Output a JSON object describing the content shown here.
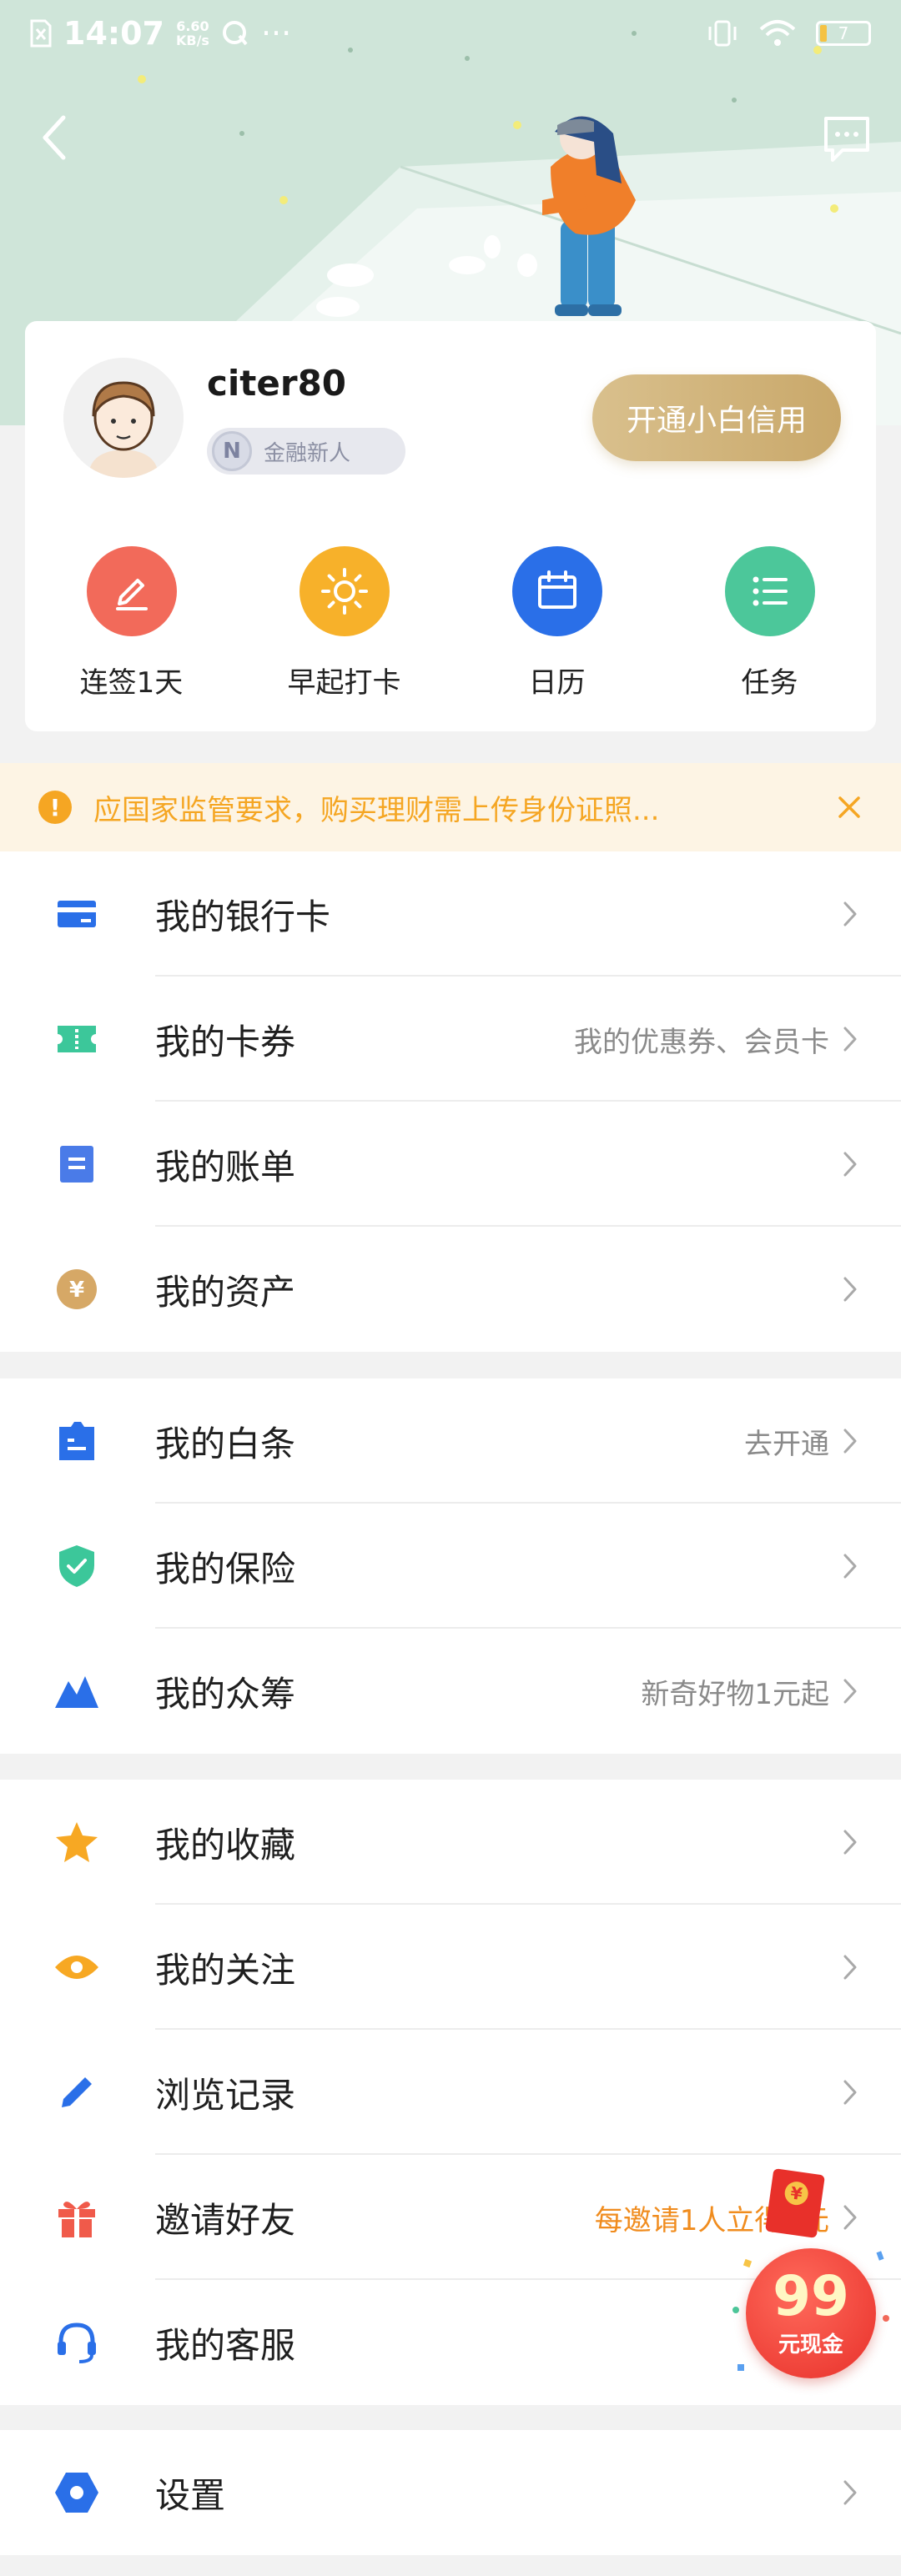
{
  "status_bar": {
    "time": "14:07",
    "net_speed_value": "6.60",
    "net_speed_unit": "KB/s",
    "more": "···",
    "battery": "7"
  },
  "profile": {
    "username": "citer80",
    "member_level": "金融新人",
    "member_icon_letter": "N",
    "credit_button": "开通小白信用"
  },
  "quick_actions": [
    {
      "label": "连签1天",
      "color": "#f26a5a",
      "icon": "pencil-icon"
    },
    {
      "label": "早起打卡",
      "color": "#f7b12a",
      "icon": "sun-icon"
    },
    {
      "label": "日历",
      "color": "#2a6fe8",
      "icon": "calendar-icon"
    },
    {
      "label": "任务",
      "color": "#4cc79a",
      "icon": "list-icon"
    }
  ],
  "notice": {
    "text": "应国家监管要求，购买理财需上传身份证照..."
  },
  "group1": [
    {
      "label": "我的银行卡",
      "hint": "",
      "icon": "bank-card-icon"
    },
    {
      "label": "我的卡券",
      "hint": "我的优惠券、会员卡",
      "icon": "coupon-icon"
    },
    {
      "label": "我的账单",
      "hint": "",
      "icon": "bill-icon"
    },
    {
      "label": "我的资产",
      "hint": "",
      "icon": "asset-icon"
    }
  ],
  "group2": [
    {
      "label": "我的白条",
      "hint": "去开通",
      "icon": "baitiao-icon"
    },
    {
      "label": "我的保险",
      "hint": "",
      "icon": "insurance-shield-icon"
    },
    {
      "label": "我的众筹",
      "hint": "新奇好物1元起",
      "icon": "crowdfunding-icon"
    }
  ],
  "group3": [
    {
      "label": "我的收藏",
      "hint": "",
      "icon": "star-icon"
    },
    {
      "label": "我的关注",
      "hint": "",
      "icon": "eye-icon"
    },
    {
      "label": "浏览记录",
      "hint": "",
      "icon": "pen-icon"
    },
    {
      "label": "邀请好友",
      "hint": "每邀请1人立得3元",
      "icon": "gift-icon"
    },
    {
      "label": "我的客服",
      "hint": "",
      "icon": "headset-icon"
    }
  ],
  "group4": [
    {
      "label": "设置",
      "hint": "",
      "icon": "settings-icon"
    }
  ],
  "promo": {
    "amount": "99",
    "label": "元现金"
  },
  "colors": {
    "accent_blue": "#2a6fe8",
    "notice_orange": "#f5a623",
    "gold": "#c9a86a"
  }
}
